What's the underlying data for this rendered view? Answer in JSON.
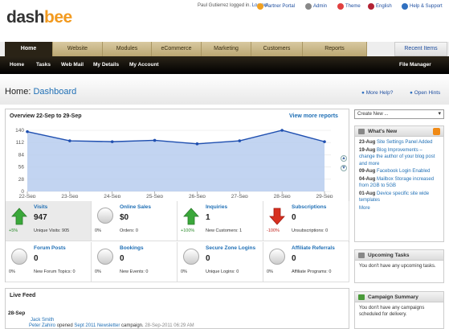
{
  "app": {
    "logo_prefix": "dash",
    "logo_suffix": "bee"
  },
  "topbar": {
    "user_text": "Paul Gutierrez logged in.",
    "logout": "Log out.",
    "links": [
      {
        "label": "Partner Portal",
        "icon": "gear-icon",
        "color": "#f0a020"
      },
      {
        "label": "Admin",
        "icon": "admin-icon",
        "color": "#888888"
      },
      {
        "label": "Theme",
        "icon": "theme-icon",
        "color": "#e04040"
      },
      {
        "label": "English",
        "icon": "flag-icon",
        "color": "#b22234"
      },
      {
        "label": "Help & Support",
        "icon": "help-icon",
        "color": "#3070c0"
      }
    ]
  },
  "tabs": [
    "Home",
    "Website",
    "Modules",
    "eCommerce",
    "Marketing",
    "Customers",
    "Reports"
  ],
  "recent_items": "Recent Items",
  "subnav": [
    "Home",
    "Tasks",
    "Web Mail",
    "My Details",
    "My Account"
  ],
  "file_manager": "File Manager",
  "page": {
    "title_prefix": "Home:",
    "title": "Dashboard",
    "more_help": "More Help?",
    "open_hints": "Open Hints"
  },
  "overview": {
    "title": "Overview 22-Sep to 29-Sep",
    "view_more": "View more reports"
  },
  "chart_data": {
    "type": "area",
    "categories": [
      "22-Sep",
      "23-Sep",
      "24-Sep",
      "25-Sep",
      "26-Sep",
      "27-Sep",
      "28-Sep",
      "29-Sep"
    ],
    "x_points": [
      "22-Sep",
      "23-Sep",
      "24-Sep",
      "25-Sep",
      "26-Sep",
      "27-Sep",
      "28-Sep",
      "29-Sep"
    ],
    "values": [
      137,
      116,
      114,
      117,
      109,
      116,
      140,
      114
    ],
    "ylim": [
      0,
      140
    ],
    "yticks": [
      0,
      28,
      56,
      84,
      112,
      140
    ],
    "line_color": "#1f4fb0",
    "fill_color": "#b7cdef",
    "grid": true
  },
  "stats": [
    {
      "label": "Visits",
      "value": "947",
      "sub": "Unique Visits: 905",
      "pct": "+5%",
      "trend": "up",
      "selected": true
    },
    {
      "label": "Online Sales",
      "value": "$0",
      "sub": "Orders: 0",
      "pct": "0%",
      "trend": "none"
    },
    {
      "label": "Inquiries",
      "value": "1",
      "sub": "New Customers: 1",
      "pct": "+100%",
      "trend": "up"
    },
    {
      "label": "Subscriptions",
      "value": "0",
      "sub": "Unsubscriptions: 0",
      "pct": "-100%",
      "trend": "down"
    },
    {
      "label": "Forum Posts",
      "value": "0",
      "sub": "New Forum Topics: 0",
      "pct": "0%",
      "trend": "none"
    },
    {
      "label": "Bookings",
      "value": "0",
      "sub": "New Events: 0",
      "pct": "0%",
      "trend": "none"
    },
    {
      "label": "Secure Zone Logins",
      "value": "0",
      "sub": "Unique Logins: 0",
      "pct": "0%",
      "trend": "none"
    },
    {
      "label": "Affiliate Referrals",
      "value": "0",
      "sub": "Affiliate Programs: 0",
      "pct": "0%",
      "trend": "none"
    }
  ],
  "feed": {
    "title": "Live Feed",
    "date": "28-Sep",
    "name": "Jack Smith",
    "actor": "Peter Zahiro",
    "verb": "opened",
    "item": "Sept 2011 Newsletter",
    "rest": "campaign.",
    "time": "28-Sep-2011 06:29 AM"
  },
  "create_new": "Create New ...",
  "whats_new": {
    "title": "What's New",
    "items": [
      {
        "date": "23-Aug",
        "text": "Site Settings Panel Added"
      },
      {
        "date": "19-Aug",
        "text": "Blog Improvements – change the author of your blog post and more"
      },
      {
        "date": "09-Aug",
        "text": "Facebook Login Enabled"
      },
      {
        "date": "04-Aug",
        "text": "Mailbox Storage increased from 2GB to 5GB"
      },
      {
        "date": "01-Aug",
        "text": "Device specific site wide templates"
      }
    ],
    "more": "More"
  },
  "upcoming": {
    "title": "Upcoming Tasks",
    "text": "You don't have any upcoming tasks."
  },
  "campaign": {
    "title": "Campaign Summary",
    "text": "You don't have any campaigns scheduled for delivery."
  }
}
